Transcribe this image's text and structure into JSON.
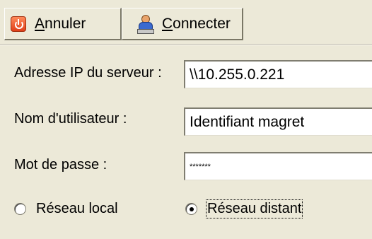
{
  "toolbar": {
    "cancel_label_prefix": "A",
    "cancel_label_rest": "nnuler",
    "connect_label_prefix": "C",
    "connect_label_rest": "onnecter"
  },
  "form": {
    "server_ip_label": "Adresse IP du serveur :",
    "server_ip_value": "\\\\10.255.0.221",
    "username_label": "Nom d'utilisateur :",
    "username_value": "Identifiant magret",
    "password_label": "Mot de passe :",
    "password_value": "*******"
  },
  "network": {
    "local_label": "Réseau local",
    "remote_label": "Réseau distant",
    "selected": "remote"
  },
  "colors": {
    "background": "#ece9d8",
    "input_background": "#ffffff"
  }
}
